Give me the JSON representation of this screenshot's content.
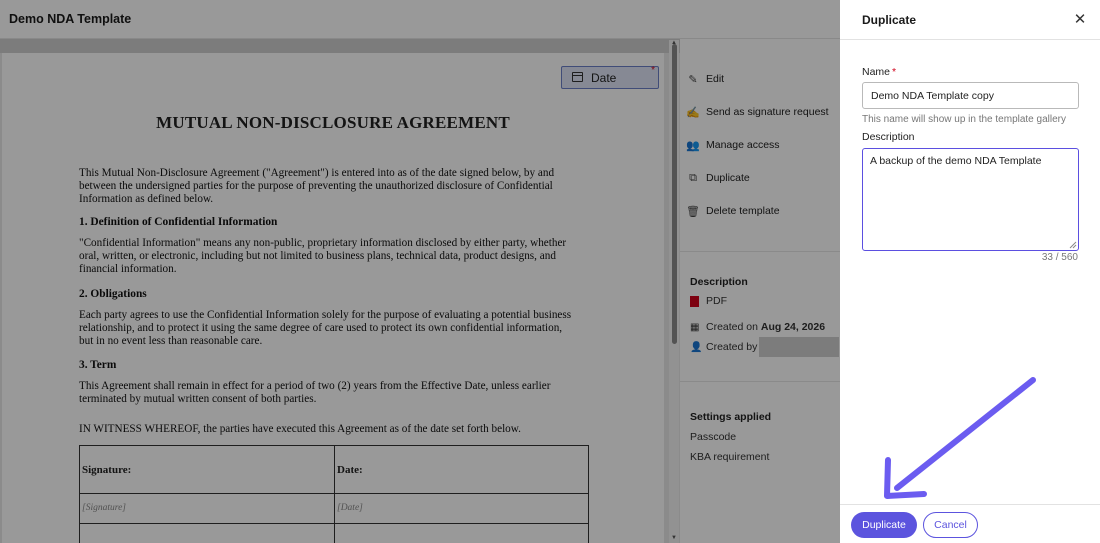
{
  "app": {
    "title": "Demo NDA Template"
  },
  "document": {
    "date_field_label": "Date",
    "date_field_required": "*",
    "title": "MUTUAL NON-DISCLOSURE AGREEMENT",
    "intro_1": "This Mutual Non-Disclosure Agreement (\"Agreement\") is entered into as of the date signed below, by and",
    "intro_2": "between the undersigned parties for the purpose of preventing the unauthorized disclosure of Confidential",
    "intro_3": "Information as defined below.",
    "s1_heading": "1. Definition of Confidential Information",
    "s1_1": "\"Confidential Information\" means any non-public, proprietary information disclosed by either party, whether",
    "s1_2": "oral, written, or electronic, including but not limited to business plans, technical data, product designs, and",
    "s1_3": "financial information.",
    "s2_heading": "2. Obligations",
    "s2_1": "Each party agrees to use the Confidential Information solely for the purpose of evaluating a potential business",
    "s2_2": "relationship, and to protect it using the same degree of care used to protect its own confidential information,",
    "s2_3": "but in no event less than reasonable care.",
    "s3_heading": "3. Term",
    "s3_1": "This Agreement shall remain in effect for a period of two (2) years from the Effective Date, unless earlier",
    "s3_2": "terminated by mutual written consent of both parties.",
    "witness": "IN WITNESS WHEREOF, the parties have executed this Agreement as of the date set forth below.",
    "table": {
      "col1_label": "Signature:",
      "col2_label": "Date:",
      "col1_placeholder": "[Signature]",
      "col2_placeholder": "[Date]"
    }
  },
  "details": {
    "actions": [
      {
        "label": "Edit",
        "icon": "pencil-icon"
      },
      {
        "label": "Send as signature request",
        "icon": "signature-icon"
      },
      {
        "label": "Manage access",
        "icon": "people-icon"
      },
      {
        "label": "Duplicate",
        "icon": "copy-icon"
      },
      {
        "label": "Delete template",
        "icon": "trash-icon"
      }
    ],
    "description_heading": "Description",
    "file_type": "PDF",
    "created_on_label": "Created on",
    "created_on_value": "Aug 24, 2026",
    "created_by_label": "Created by",
    "settings_heading": "Settings applied",
    "settings": [
      "Passcode",
      "KBA requirement"
    ]
  },
  "dialog": {
    "title": "Duplicate",
    "name_label": "Name",
    "name_required": "*",
    "name_value": "Demo NDA Template copy",
    "name_hint": "This name will show up in the template gallery",
    "description_label": "Description",
    "description_value": "A backup of the demo NDA Template",
    "char_count": "33 / 560",
    "primary_button": "Duplicate",
    "secondary_button": "Cancel"
  },
  "colors": {
    "accent": "#5c54de",
    "required": "#d0021b",
    "annotation_arrow": "#6b5cf0"
  }
}
